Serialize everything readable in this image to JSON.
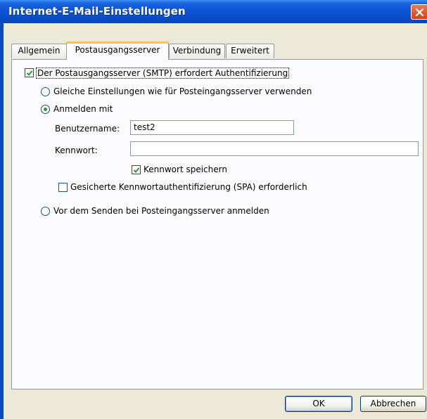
{
  "window": {
    "title": "Internet-E-Mail-Einstellungen"
  },
  "tabs": [
    {
      "label": "Allgemein",
      "active": false
    },
    {
      "label": "Postausgangsserver",
      "active": true
    },
    {
      "label": "Verbindung",
      "active": false
    },
    {
      "label": "Erweitert",
      "active": false
    }
  ],
  "smtp": {
    "requires_auth_label": "Der Postausgangsserver (SMTP) erfordert Authentifizierung",
    "requires_auth_checked": true,
    "same_settings_label": "Gleiche Einstellungen wie für Posteingangsserver verwenden",
    "same_settings_selected": false,
    "login_with_label": "Anmelden mit",
    "login_with_selected": true,
    "username_label": "Benutzername:",
    "username_value": "test2",
    "password_label": "Kennwort:",
    "password_value": "",
    "save_password_label": "Kennwort speichern",
    "save_password_checked": true,
    "spa_label": "Gesicherte Kennwortauthentifizierung (SPA) erforderlich",
    "spa_checked": false,
    "login_before_send_label": "Vor dem Senden bei Posteingangsserver anmelden",
    "login_before_send_selected": false
  },
  "buttons": {
    "ok_label": "OK",
    "cancel_label": "Abbrechen"
  },
  "icons": {
    "close": "close-icon",
    "check": "checkmark-icon"
  },
  "colors": {
    "titlebar": "#0a4ec9",
    "close_button": "#d3421d",
    "active_tab_accent": "#ffc83c",
    "checkmark": "#21a121",
    "dialog_background": "#ece9d8"
  }
}
